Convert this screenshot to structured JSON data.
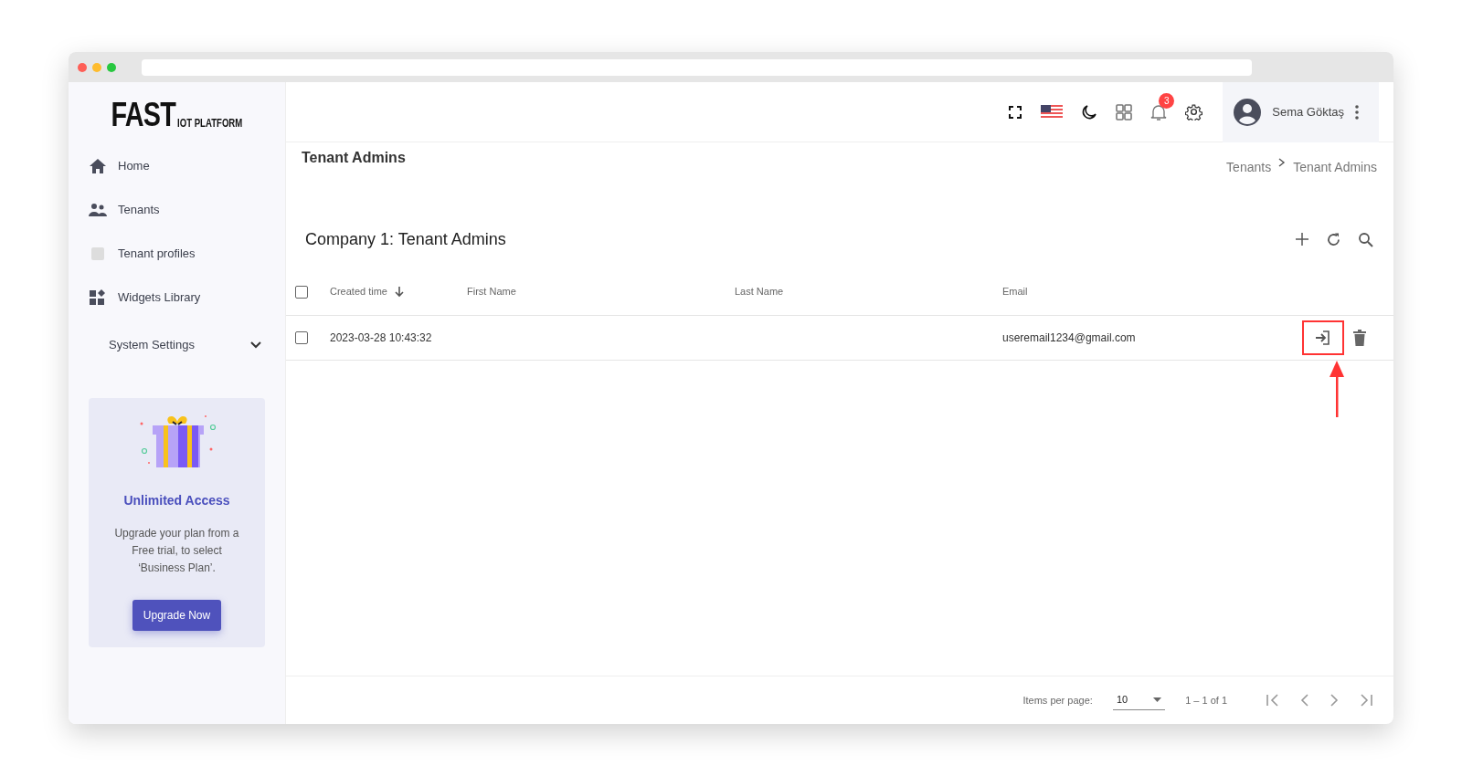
{
  "logo": {
    "main": "FAST",
    "sub": "IOT PLATFORM"
  },
  "sidebar": {
    "items": [
      {
        "kind": "home",
        "label": "Home"
      },
      {
        "kind": "tenants",
        "label": "Tenants"
      },
      {
        "kind": "profiles",
        "label": "Tenant profiles"
      },
      {
        "kind": "widgets",
        "label": "Widgets Library"
      },
      {
        "kind": "group",
        "label": "System Settings",
        "expanded": false
      }
    ],
    "promo": {
      "title": "Unlimited Access",
      "text": "Upgrade your plan from a Free trial, to select ‘Business Plan’.",
      "button": "Upgrade Now"
    }
  },
  "header": {
    "notifications": "3",
    "user": "Sema Göktaş"
  },
  "page": {
    "title": "Tenant Admins",
    "breadcrumb": [
      "Tenants",
      "Tenant Admins"
    ]
  },
  "table": {
    "title": "Company 1: Tenant Admins",
    "columns": [
      "Created time",
      "First Name",
      "Last Name",
      "Email"
    ],
    "rows": [
      {
        "selected": false,
        "cells": [
          "2023-03-28 10:43:32",
          "",
          "",
          "useremail1234@gmail.com"
        ],
        "highlighted": true
      }
    ],
    "all_selected": false,
    "pagination": {
      "label": "Items per page:",
      "value": "10",
      "range": "1 – 1 of 1"
    }
  }
}
